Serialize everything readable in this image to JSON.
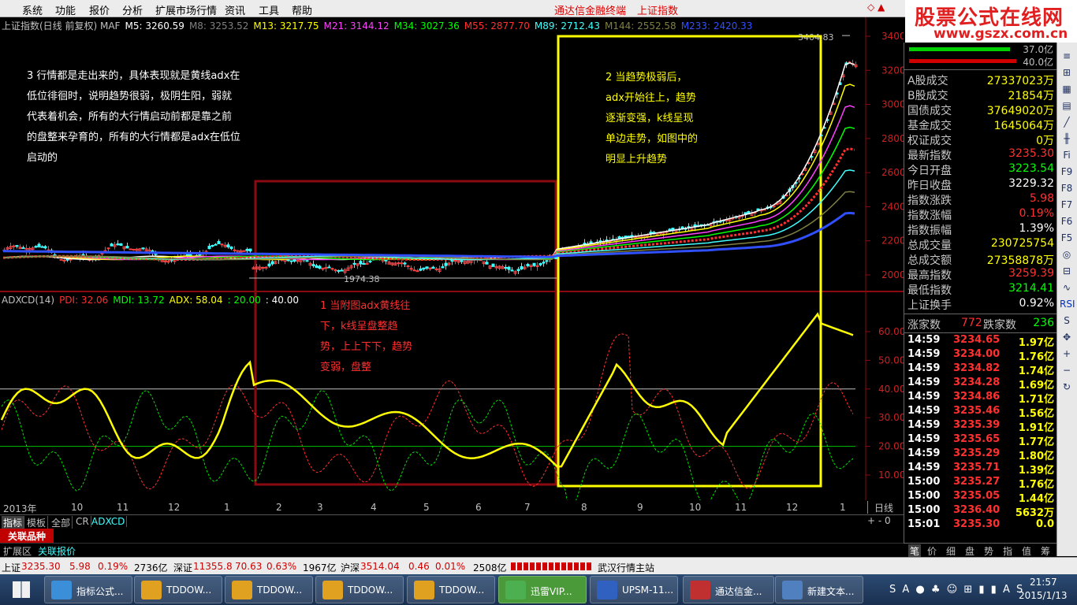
{
  "menu": {
    "items": [
      "系统",
      "功能",
      "报价",
      "分析",
      "扩展市场行情",
      "资讯",
      "工具",
      "帮助"
    ],
    "center_title": "通达信金融终端",
    "center_subtitle": "上证指数"
  },
  "logo": {
    "line1": "股票公式在线网",
    "line2": "www.gszx.com.cn"
  },
  "chart": {
    "window_corner": "◇ ▲",
    "ma_legend": [
      {
        "text": "上证指数(日线 前复权) MAF",
        "color": "#c0c0c0"
      },
      {
        "text": "M5: 3260.59",
        "color": "#ffffff"
      },
      {
        "text": "M8: 3253.52",
        "color": "#808080"
      },
      {
        "text": "M13: 3217.75",
        "color": "#ffff00"
      },
      {
        "text": "M21: 3144.12",
        "color": "#ff40ff"
      },
      {
        "text": "M34: 3027.36",
        "color": "#00ff00"
      },
      {
        "text": "M55: 2877.70",
        "color": "#ff3030"
      },
      {
        "text": "M89: 2712.43",
        "color": "#40ffff"
      },
      {
        "text": "M144: 2552.58",
        "color": "#808040"
      },
      {
        "text": "M233: 2420.33",
        "color": "#3050ff"
      }
    ],
    "adx_legend": [
      {
        "text": "ADXCD(14)",
        "color": "#c0c0c0"
      },
      {
        "text": "PDI: 32.06",
        "color": "#ff3030"
      },
      {
        "text": "MDI: 13.72",
        "color": "#00ff00"
      },
      {
        "text": "ADX: 58.04",
        "color": "#ffff00"
      },
      {
        "text": ": 20.00",
        "color": "#00ff00"
      },
      {
        "text": ": 40.00",
        "color": "#ffffff"
      }
    ],
    "high_label": "3404.83",
    "low_label": "1974.38",
    "price_axis": [
      "3400",
      "3200",
      "3000",
      "2800",
      "2600",
      "2400",
      "2200",
      "2000"
    ],
    "adx_axis": [
      "60.00",
      "50.00",
      "40.00",
      "30.00",
      "20.00",
      "10.00"
    ],
    "time_axis": [
      "2013年",
      "10",
      "11",
      "12",
      "1",
      "2",
      "3",
      "4",
      "5",
      "6",
      "7",
      "8",
      "9",
      "10",
      "11",
      "12",
      "1"
    ],
    "period_button": "日线",
    "note3": [
      "3 行情都是走出来的，具体表现就是黄线adx在",
      "低位徘徊时，说明趋势很弱，极阴生阳，弱就",
      "代表着机会，所有的大行情启动前都是靠之前",
      "的盘整来孕育的，所有的大行情都是adx在低位",
      "启动的"
    ],
    "note2": [
      "2 当趋势极弱后，",
      "adx开始往上，趋势",
      "逐渐变强，k线呈现",
      "单边走势，如图中的",
      "明显上升趋势"
    ],
    "note1": [
      "1 当附图adx黄线往",
      "下，k线呈盘整趋",
      "势，上上下下，趋势",
      "变弱，盘整"
    ],
    "colors": {
      "box_dark_red": "#8b0a12",
      "box_yellow": "#ffff00",
      "note_red": "#ff3030",
      "note_yellow": "#ffff00",
      "note_white": "#ffffff"
    }
  },
  "tabs": [
    "指标",
    "模板",
    "全部",
    "CR",
    "ADXCD"
  ],
  "tab_controls": "+ - 0",
  "guanlian": "关联品种",
  "tabs2": [
    "扩展区",
    "关联报价"
  ],
  "right_panel": {
    "bar_values": [
      "37.0亿",
      "40.0亿"
    ],
    "stats": [
      {
        "label": "A股成交",
        "value": "27337023万",
        "color": "#ffff00"
      },
      {
        "label": "B股成交",
        "value": "21854万",
        "color": "#ffff00"
      },
      {
        "label": "国债成交",
        "value": "37649020万",
        "color": "#ffff00"
      },
      {
        "label": "基金成交",
        "value": "1645064万",
        "color": "#ffff00"
      },
      {
        "label": "权证成交",
        "value": "0万",
        "color": "#ffff00"
      },
      {
        "label": "最新指数",
        "value": "3235.30",
        "color": "#ff3030"
      },
      {
        "label": "今日开盘",
        "value": "3223.54",
        "color": "#00ff00"
      },
      {
        "label": "昨日收盘",
        "value": "3229.32",
        "color": "#ffffff"
      },
      {
        "label": "指数涨跌",
        "value": "5.98",
        "color": "#ff3030"
      },
      {
        "label": "指数涨幅",
        "value": "0.19%",
        "color": "#ff3030"
      },
      {
        "label": "指数振幅",
        "value": "1.39%",
        "color": "#ffffff"
      },
      {
        "label": "总成交量",
        "value": "230725754",
        "color": "#ffff00"
      },
      {
        "label": "总成交额",
        "value": "27358878万",
        "color": "#ffff00"
      },
      {
        "label": "最高指数",
        "value": "3259.39",
        "color": "#ff3030"
      },
      {
        "label": "最低指数",
        "value": "3214.41",
        "color": "#00ff00"
      },
      {
        "label": "上证换手",
        "value": "0.92%",
        "color": "#ffffff"
      }
    ],
    "updown": {
      "up_label": "涨家数",
      "up_value": "772",
      "down_label": "跌家数",
      "down_value": "236"
    },
    "ticks": [
      {
        "time": "14:59",
        "price": "3234.65",
        "amount": "1.97亿"
      },
      {
        "time": "14:59",
        "price": "3234.00",
        "amount": "1.76亿"
      },
      {
        "time": "14:59",
        "price": "3234.82",
        "amount": "1.74亿"
      },
      {
        "time": "14:59",
        "price": "3234.28",
        "amount": "1.69亿"
      },
      {
        "time": "14:59",
        "price": "3234.86",
        "amount": "1.71亿"
      },
      {
        "time": "14:59",
        "price": "3235.46",
        "amount": "1.56亿"
      },
      {
        "time": "14:59",
        "price": "3235.39",
        "amount": "1.91亿"
      },
      {
        "time": "14:59",
        "price": "3235.65",
        "amount": "1.77亿"
      },
      {
        "time": "14:59",
        "price": "3235.29",
        "amount": "1.80亿"
      },
      {
        "time": "14:59",
        "price": "3235.71",
        "amount": "1.39亿"
      },
      {
        "time": "15:00",
        "price": "3235.27",
        "amount": "1.76亿"
      },
      {
        "time": "15:00",
        "price": "3235.05",
        "amount": "1.44亿"
      },
      {
        "time": "15:00",
        "price": "3236.40",
        "amount": "5632万"
      },
      {
        "time": "15:01",
        "price": "3235.30",
        "amount": "0.0"
      }
    ],
    "bottom_tabs": [
      "笔",
      "价",
      "细",
      "盘",
      "势",
      "指",
      "值",
      "筹"
    ]
  },
  "tool_icons": [
    "menu-icon",
    "grid-icon",
    "chart-icon",
    "bar-icon",
    "line-icon",
    "kline-icon",
    "fund-icon",
    "f10-icon",
    "f9-icon",
    "f8-icon",
    "f7-icon",
    "f6-icon",
    "search-icon",
    "compare-icon",
    "indicator-icon",
    "rsi-icon",
    "stock-icon",
    "move-icon",
    "zoom-in-icon",
    "zoom-out-icon",
    "refresh-icon"
  ],
  "tool_labels": [
    "≡",
    "⊞",
    "▦",
    "▤",
    "╱",
    "╫",
    "Fi",
    "F9",
    "F8",
    "F7",
    "F6",
    "F5",
    "◎",
    "⊟",
    "∿",
    "RSI",
    "S",
    "✥",
    "+",
    "−",
    "↻"
  ],
  "status": {
    "sh_label": "上证",
    "sh_val": "3235.30",
    "sh_chg": "5.98",
    "sh_pct": "0.19%",
    "sh_amt": "2736亿",
    "sz_label": "深证",
    "sz_val": "11355.8",
    "sz_chg": "70.63",
    "sz_pct": "0.63%",
    "sz_amt": "1967亿",
    "hs_label": "沪深",
    "hs_val": "3514.04",
    "hs_chg": "0.46",
    "hs_pct": "0.01%",
    "hs_amt": "2508亿",
    "server": "武汉行情主站"
  },
  "taskbar": {
    "items": [
      "指标公式...",
      "TDDOW...",
      "TDDOW...",
      "TDDOW...",
      "TDDOW...",
      "迅雷VIP...",
      "UPSM-11...",
      "通达信金...",
      "新建文本..."
    ],
    "item_colors": [
      "#3a8fd8",
      "#e0a020",
      "#e0a020",
      "#e0a020",
      "#e0a020",
      "#4caf50",
      "#3060c0",
      "#c03030",
      "#5080c0"
    ],
    "time": "21:57",
    "date": "2015/1/13",
    "tray": "S A ● ♣ ☺ ⊞ ▮ ▮ A S"
  }
}
